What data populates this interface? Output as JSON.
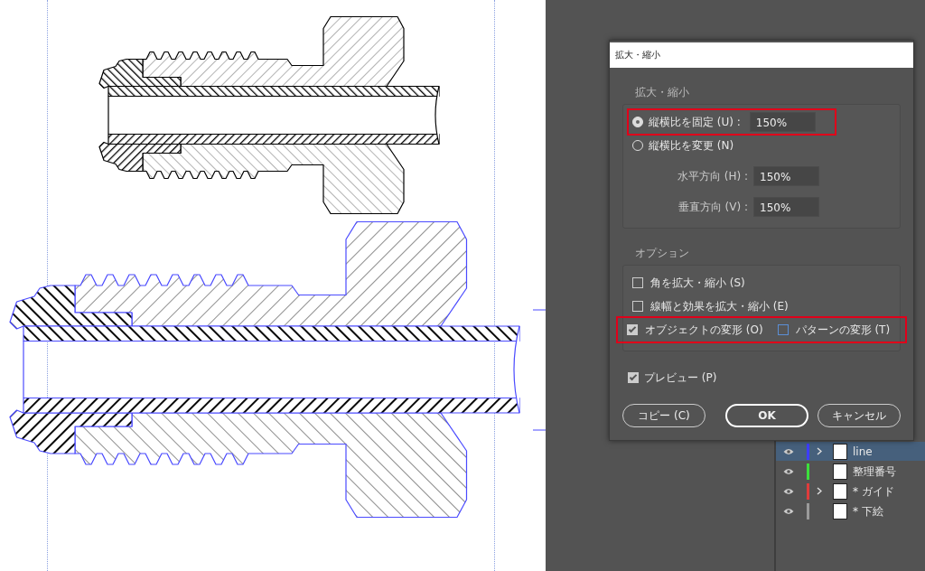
{
  "dialog": {
    "title": "拡大・縮小",
    "scale_group": {
      "heading": "拡大・縮小",
      "radios": [
        {
          "label": "縦横比を固定 (U) :",
          "selected": true,
          "value": "150%",
          "highlighted": true
        },
        {
          "label": "縦横比を変更 (N)",
          "selected": false,
          "highlighted": false
        }
      ],
      "fields": [
        {
          "label": "水平方向 (H) :",
          "value": "150%"
        },
        {
          "label": "垂直方向 (V) :",
          "value": "150%"
        }
      ]
    },
    "options_group": {
      "heading": "オプション",
      "rows": [
        {
          "highlighted": false,
          "checkboxes": [
            {
              "label": "角を拡大・縮小 (S)",
              "checked": false
            }
          ]
        },
        {
          "highlighted": false,
          "checkboxes": [
            {
              "label": "線幅と効果を拡大・縮小 (E)",
              "checked": false
            }
          ]
        },
        {
          "highlighted": true,
          "checkboxes": [
            {
              "label": "オブジェクトの変形 (O)",
              "checked": true
            },
            {
              "label": "パターンの変形 (T)",
              "checked": false
            }
          ]
        }
      ]
    },
    "preview": {
      "label": "プレビュー (P)",
      "checked": true
    },
    "buttons": [
      {
        "label": "コピー (C)",
        "default": false
      },
      {
        "label": "OK",
        "default": true
      },
      {
        "label": "キャンセル",
        "default": false
      }
    ]
  },
  "layers": [
    {
      "name": "line",
      "color": "#3d3dff",
      "expandable": true,
      "selected": true
    },
    {
      "name": "整理番号",
      "color": "#3ce03c",
      "expandable": false,
      "selected": false
    },
    {
      "name": "* ガイド",
      "color": "#e03c3c",
      "expandable": true,
      "selected": false
    },
    {
      "name": "* 下絵",
      "color": "#9a9a9a",
      "expandable": false,
      "selected": false
    }
  ]
}
